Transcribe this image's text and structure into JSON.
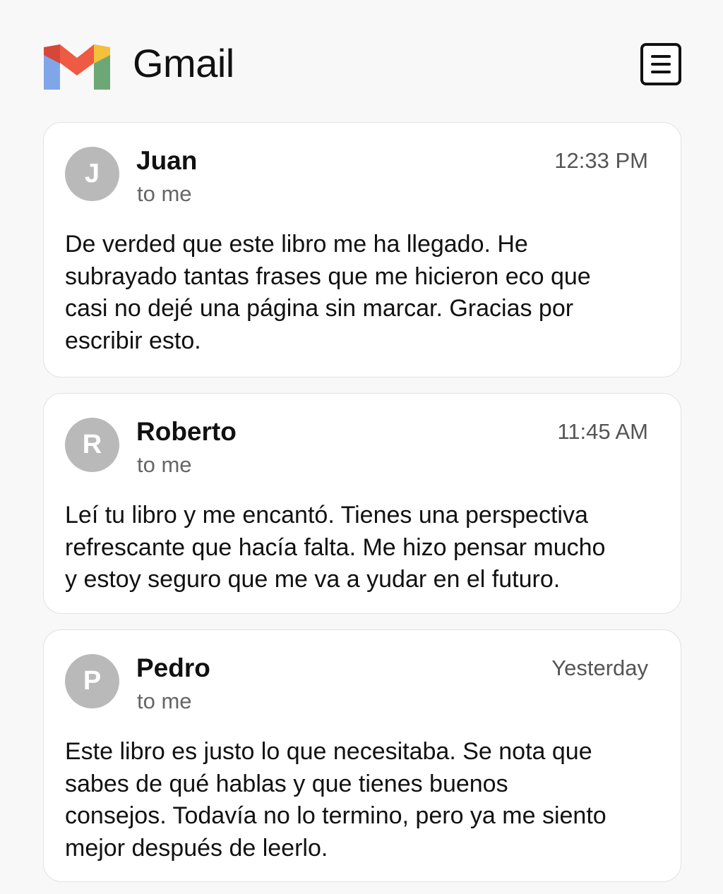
{
  "app": {
    "title": "Gmail",
    "logo": "gmail-logo",
    "menu_icon": "menu-list-icon"
  },
  "emails": [
    {
      "initial": "J",
      "sender": "Juan",
      "recipient": "to me",
      "time": "12:33 PM",
      "body": "De verded que este libro me ha llegado. He\nsubrayado tantas frases que me hicieron eco que\ncasi no dejé una página sin marcar. Gracias por\nescribir esto."
    },
    {
      "initial": "R",
      "sender": "Roberto",
      "recipient": "to me",
      "time": "11:45 AM",
      "body": "Leí tu libro y me encantó. Tienes una perspectiva\nrefrescante que hacía falta. Me hizo pensar mucho\ny estoy seguro que me va a yudar en el futuro."
    },
    {
      "initial": "P",
      "sender": "Pedro",
      "recipient": "to me",
      "time": "Yesterday",
      "body": "Este libro es justo lo que necesitaba. Se nota que\nsabes de qué hablas y que tienes buenos\nconsejos. Todavía no lo termino, pero ya me siento\nmejor después de leerlo."
    }
  ],
  "colors": {
    "avatar": "#b9b9b9",
    "gmail_blue": "#7fa6e8",
    "gmail_red": "#ef5a43",
    "gmail_yellow": "#f3c13b",
    "gmail_green": "#6ea776"
  }
}
